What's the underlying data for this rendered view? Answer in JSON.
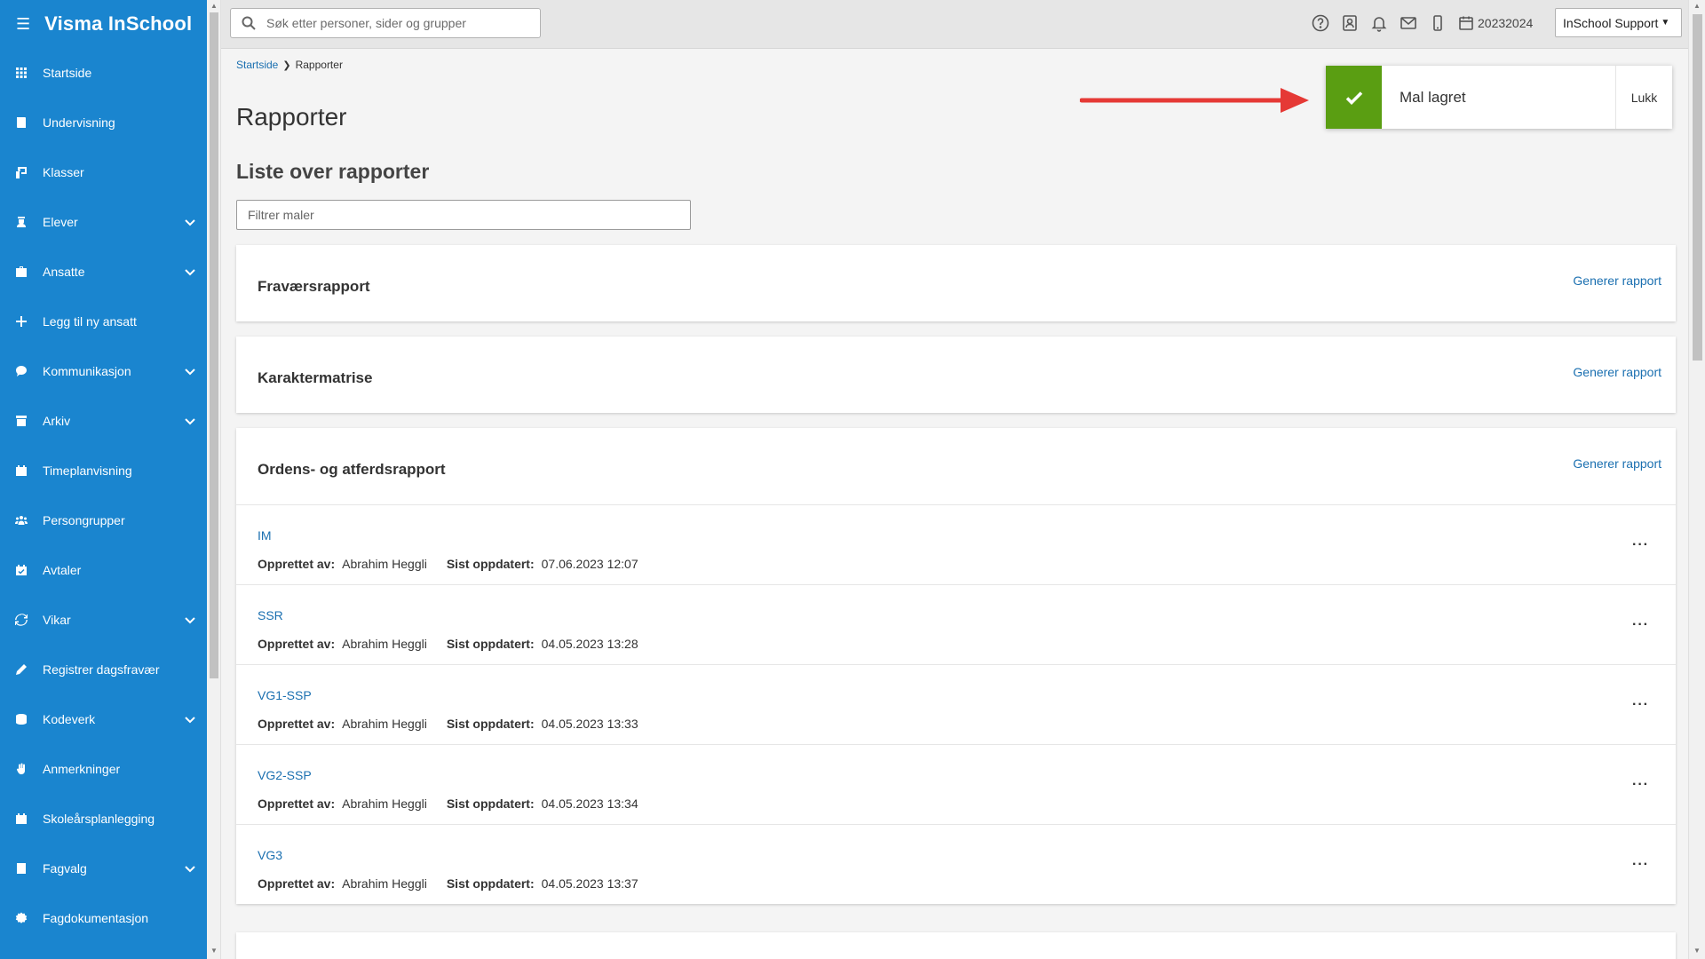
{
  "app": {
    "title": "Visma InSchool"
  },
  "sidebar": {
    "items": [
      {
        "label": "Startside",
        "icon": "grid-icon",
        "expandable": false
      },
      {
        "label": "Undervisning",
        "icon": "book-icon",
        "expandable": false
      },
      {
        "label": "Klasser",
        "icon": "classroom-icon",
        "expandable": false
      },
      {
        "label": "Elever",
        "icon": "student-icon",
        "expandable": true
      },
      {
        "label": "Ansatte",
        "icon": "briefcase-icon",
        "expandable": true
      },
      {
        "label": "Legg til ny ansatt",
        "icon": "plus-icon",
        "expandable": false
      },
      {
        "label": "Kommunikasjon",
        "icon": "chat-icon",
        "expandable": true
      },
      {
        "label": "Arkiv",
        "icon": "archive-icon",
        "expandable": true
      },
      {
        "label": "Timeplanvisning",
        "icon": "calendar-icon",
        "expandable": false
      },
      {
        "label": "Persongrupper",
        "icon": "people-icon",
        "expandable": false
      },
      {
        "label": "Avtaler",
        "icon": "calendar-check-icon",
        "expandable": false
      },
      {
        "label": "Vikar",
        "icon": "sync-icon",
        "expandable": true
      },
      {
        "label": "Registrer dagsfravær",
        "icon": "pencil-icon",
        "expandable": false
      },
      {
        "label": "Kodeverk",
        "icon": "database-icon",
        "expandable": true
      },
      {
        "label": "Anmerkninger",
        "icon": "hand-icon",
        "expandable": false
      },
      {
        "label": "Skoleårsplanlegging",
        "icon": "calendar-grid-icon",
        "expandable": false
      },
      {
        "label": "Fagvalg",
        "icon": "book-open-icon",
        "expandable": true
      },
      {
        "label": "Fagdokumentasjon",
        "icon": "badge-icon",
        "expandable": false
      }
    ]
  },
  "topbar": {
    "search_placeholder": "Søk etter personer, sider og grupper",
    "school_year": "20232024",
    "user_label": "InSchool Support"
  },
  "breadcrumb": {
    "home": "Startside",
    "current": "Rapporter"
  },
  "page": {
    "title": "Rapporter",
    "section_title": "Liste over rapporter",
    "filter_placeholder": "Filtrer maler"
  },
  "cards": [
    {
      "title": "Fraværsrapport",
      "action": "Generer rapport"
    },
    {
      "title": "Karaktermatrise",
      "action": "Generer rapport"
    },
    {
      "title": "Ordens- og atferdsrapport",
      "action": "Generer rapport"
    }
  ],
  "report_meta_labels": {
    "created_by": "Opprettet av:",
    "updated": "Sist oppdatert:"
  },
  "reports": [
    {
      "name": "IM",
      "created_by": "Abrahim Heggli",
      "updated": "07.06.2023 12:07"
    },
    {
      "name": "SSR",
      "created_by": "Abrahim Heggli",
      "updated": "04.05.2023 13:28"
    },
    {
      "name": "VG1-SSP",
      "created_by": "Abrahim Heggli",
      "updated": "04.05.2023 13:33"
    },
    {
      "name": "VG2-SSP",
      "created_by": "Abrahim Heggli",
      "updated": "04.05.2023 13:34"
    },
    {
      "name": "VG3",
      "created_by": "Abrahim Heggli",
      "updated": "04.05.2023 13:37"
    }
  ],
  "toast": {
    "message": "Mal lagret",
    "close_label": "Lukk"
  },
  "colors": {
    "sidebar": "#1a85cf",
    "link": "#1a6fb0",
    "success": "#5a9e12",
    "arrow": "#e53935"
  }
}
